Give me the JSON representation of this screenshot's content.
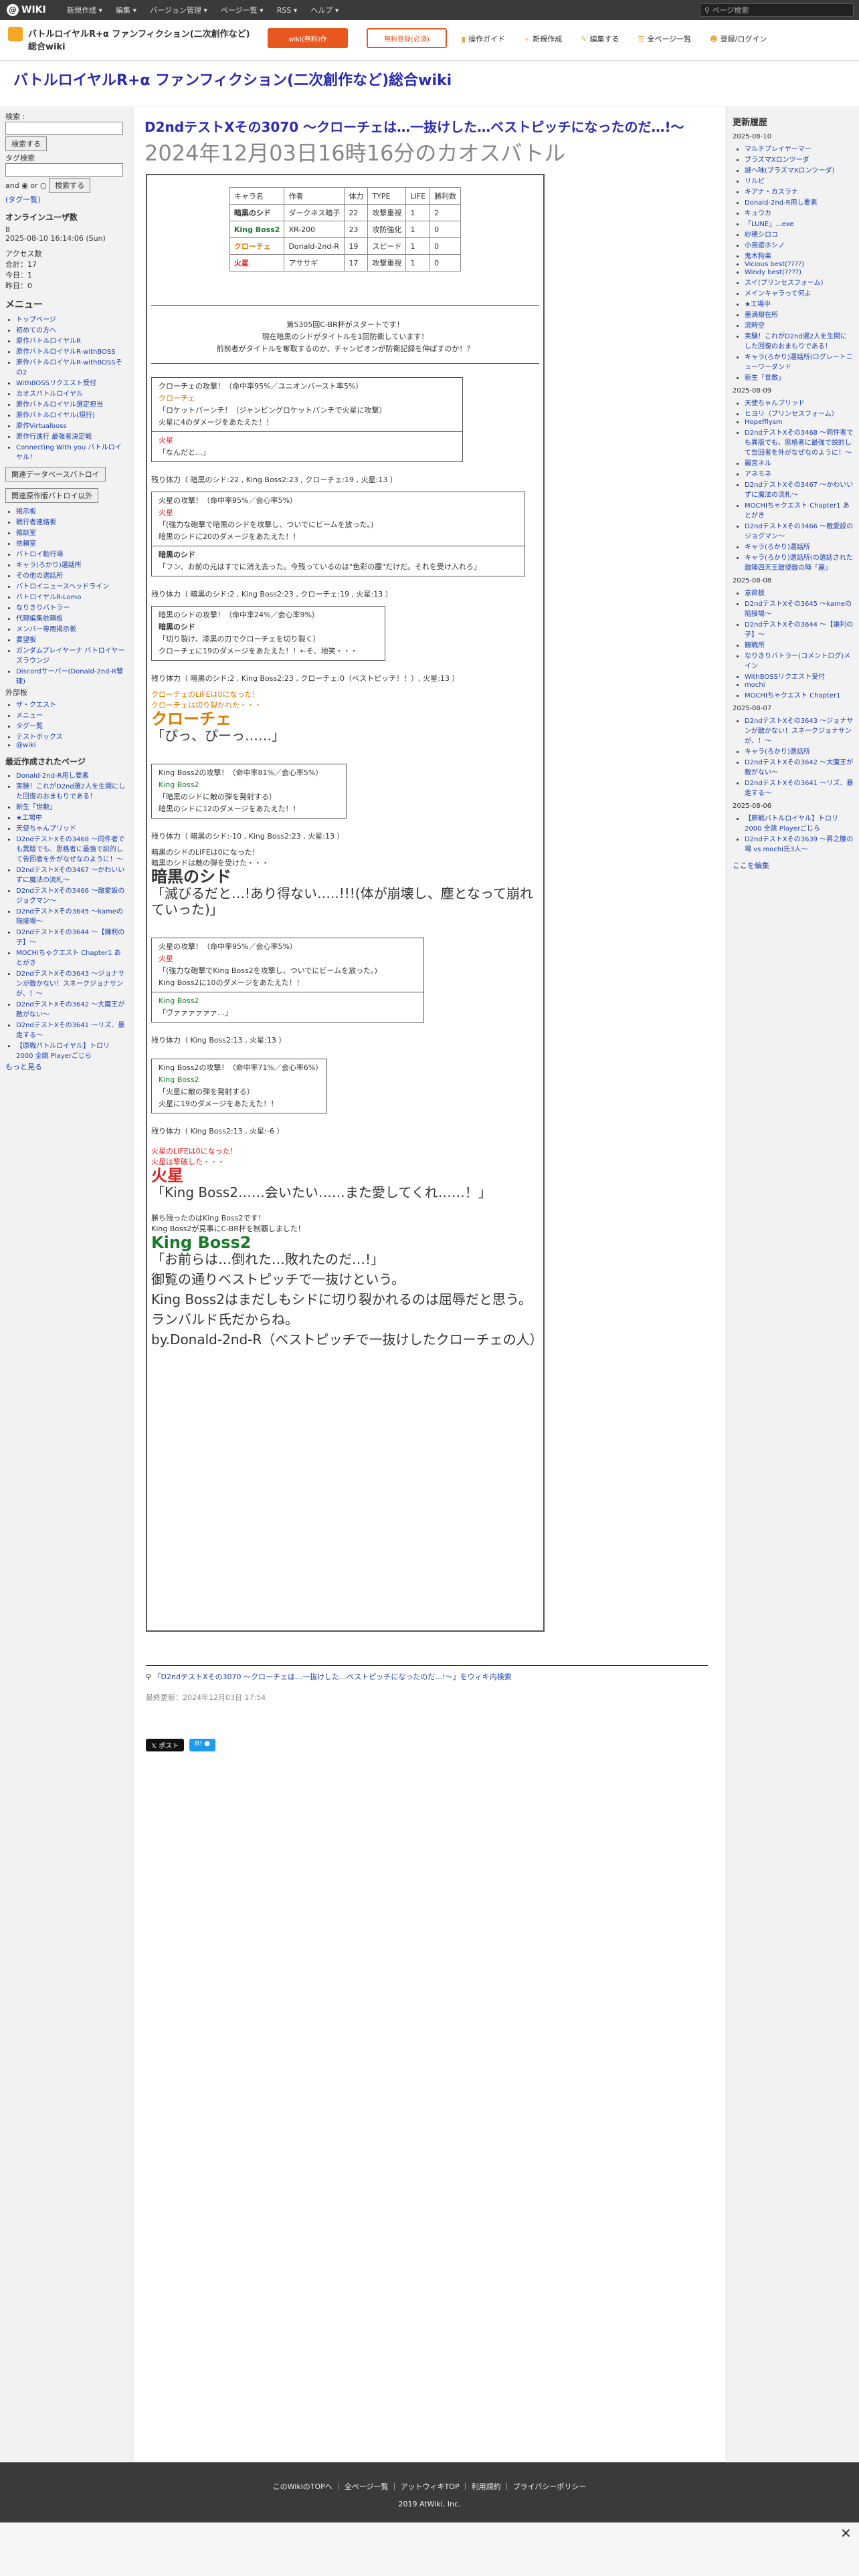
{
  "topbar": {
    "logo": "WIKI",
    "menus": [
      "新規作成 ▾",
      "編集 ▾",
      "バージョン管理 ▾",
      "ページ一覧 ▾",
      "RSS ▾",
      "ヘルプ ▾"
    ],
    "search_placeholder": "ページ検索"
  },
  "header": {
    "wiki_name": "バトルロイヤルR+α ファンフィクション(二次創作など)総合wiki",
    "btn_orange": "wiki(無料)作",
    "btn_white": "無料登録(必須)",
    "nav": [
      "操作ガイド",
      "新規作成",
      "編集する",
      "全ページ一覧",
      "登録/ログイン"
    ]
  },
  "page_title": "バトルロイヤルR+α ファンフィクション(二次創作など)総合wiki",
  "left": {
    "search_label": "検索 :",
    "search_btn": "検索する",
    "tag_label": "タグ検索",
    "and_or": "and ◉ or ○",
    "search_btn2": "検索する",
    "tag_list": "(タグ一覧)",
    "online_label": "オンラインユーザ数",
    "online_count": "8",
    "timestamp": "2025-08-10 16:14:06 (Sun)",
    "access_label": "アクセス数",
    "access_lines": [
      "合計：17",
      "今日：1",
      "昨日：0"
    ],
    "menu_title": "メニュー",
    "menu_items": [
      "トップページ",
      "初めての方へ",
      "原作バトルロイヤルR",
      "原作バトルロイヤルR-withBOSS",
      "原作バトルロイヤルR-withBOSSその2",
      "WithBOSSリクエスト受付",
      "カオスバトルロイヤル",
      "原作バトルロイヤル選定担当",
      "原作バトルロイヤル(現行)",
      "原作Virtualboss",
      "原作行進行 最強者決定戦",
      "Connecting With you バトルロイヤル！"
    ],
    "related_btns": [
      "関連データベースバトロイ",
      "関連原作版バトロイ以外"
    ],
    "sub_items": [
      "掲示板",
      "戦行者連絡板",
      "雑談室",
      "依頼室",
      "バトロイ勧行場",
      "キャラ(ろかり)選話所",
      "その他の選話所",
      "バトロイニュースヘッドライン",
      "バトロイヤルR-Lomo",
      "なりきりバトラー",
      "代理編集依頼板",
      "メンバー専用掲示板",
      "要望板",
      "ガンダムプレイヤーナ バトロイヤーズラウンジ",
      "Discordサーバー(Donald-2nd-R管理)"
    ],
    "ext_label": "外部板",
    "ext_items": [
      "ザ・クエスト",
      "メニュー",
      "タグ一覧",
      "テストボックス",
      "@wiki"
    ],
    "recent_title": "最近作成されたページ",
    "recent_items": [
      "Donald-2nd-R用し要素",
      "実験！これがD2nd選2人を生開にした回復のおまもりである！",
      "新生「世敷」",
      "★工場中",
      "天使ちゃんプリッド",
      "D2ndテストXその3468 〜同件者でも異版でも、思格者に最強で説的して告回者を外がなぜなのように！〜",
      "D2ndテストXその3467 〜かわいいずに魔法の流札〜",
      "D2ndテストXその3466 〜敵愛設のジョグマン〜",
      "D2ndテストXその3645 〜kameの陥接場〜",
      "D2ndテストXその3644 〜【嫌利の子】〜",
      "MOCHIちゃクエスト Chapter1 あとがき",
      "D2ndテストXその3643 〜ジョナサンが敵かない！スネークジョナサンが、！〜",
      "D2ndテストXその3642 〜大魔王が敵がない〜",
      "D2ndテストXその3641 〜リズ、暴走する〜",
      "【原戦バトルロイヤル】トロリ2000 全跳 Playerごじら"
    ],
    "more_recent": "もっと見る"
  },
  "right": {
    "title": "更新履歴",
    "groups": [
      {
        "date": "2025-08-10",
        "items": [
          "マルチプレイヤーマー",
          "ブラズマXロンツーダ",
          "謎へ味(ブラズマXロンツーダ)",
          "リルビ",
          "キアナ・カスラナ",
          "Donald-2nd-R用し要素",
          "キュウカ",
          "「LUNE」...exe",
          "紗穂シロコ",
          "小鳥遊ホシノ",
          "鬼木狗楽",
          "Vicious best(????)",
          "Windy best(????)",
          "スイ(プリンセスフォーム)",
          "メインキャラって何よ",
          "★工場中",
          "墨満樹在所",
          "流時空",
          "実験！これがD2nd選2人を生開にした回復のおまもりである！",
          "キャラ(ろかり)選話所(ログレートニューワーダンド",
          "新生「世敷」"
        ]
      },
      {
        "date": "2025-08-09",
        "items": [
          "天使ちゃんプリッド",
          "ヒヨリ（プリンセスフォーム）",
          "Hopefflysm",
          "D2ndテストXその3468 〜同件者でも異版でも、思格者に最強で説的して告回者を外がなぜなのように！〜",
          "麗宮ネル",
          "アネモネ",
          "D2ndテストXその3467 〜かわいいずに魔法の流札〜",
          "MOCHIちゃクエスト Chapter1 あとがき",
          "D2ndテストXその3466 〜敵愛設のジョグマン〜",
          "キャラ(ろかり)選話所",
          "キャラ(ろかり)選話所(の選話された敵陣四天王敵侵敵の陣「麗」"
        ]
      },
      {
        "date": "2025-08-08",
        "items": [
          "意欲板",
          "D2ndテストXその3645 〜kameの陥接場〜",
          "D2ndテストXその3644 〜【嫌利の子】〜",
          "観戦所",
          "なりきりバトラー(コメントログ)メイン",
          "WithBOSSリクエスト受付",
          "mochi",
          "MOCHIちゃクエスト Chapter1"
        ]
      },
      {
        "date": "2025-08-07",
        "items": [
          "D2ndテストXその3643 〜ジョナサンが敵かない！スネークジョナサンが、！〜",
          "キャラ(ろかり)選話所",
          "D2ndテストXその3642 〜大魔王が敵がない〜",
          "D2ndテストXその3641 〜リズ、暴走する〜"
        ]
      },
      {
        "date": "2025-08-06",
        "items": [
          "【原戦バトルロイヤル】トロリ2000 全跳 Playerごじら",
          "D2ndテストXその3639 〜昇之腰の場 vs mochi氏3人〜"
        ]
      }
    ],
    "more": "ここを編集"
  },
  "article": {
    "title": "D2ndテストXその3070 〜クローチェは…一抜けした…ベストピッチになったのだ…!〜",
    "date": "2024年12月03日16時16分のカオスバトル",
    "table_header": [
      "キャラ名",
      "作者",
      "体力",
      "TYPE",
      "LIFE",
      "勝利数"
    ],
    "table_rows": [
      [
        "暗黒のシド",
        "ダークネス暗子",
        "22",
        "攻撃重視",
        "1",
        "2"
      ],
      [
        "King Boss2",
        "XR-200",
        "23",
        "攻防強化",
        "1",
        "0"
      ],
      [
        "クローチェ",
        "Donald-2nd-R",
        "19",
        "スピード",
        "1",
        "0"
      ],
      [
        "火星",
        "アササギ",
        "17",
        "攻撃重視",
        "1",
        "0"
      ]
    ],
    "intro": [
      "第5305回C-BR杯がスタートです！",
      "現在暗黒のシドがタイトルを1回防衛しています！",
      "前前者がタイトルを奪取するのか、チャンピオンが防衛記録を伸ばすのか！？"
    ],
    "f1": [
      "クローチェの攻撃！（命中率95%／ユニオンバースト率5%）",
      "クローチェ",
      "「ロケットパーンチ！（ジャンピングロケットパンチで火星に攻撃）",
      "火星に4のダメージをあたえた！！",
      "火星",
      "「なんだと…」"
    ],
    "hp1": "残り体力（ 暗黒のシド:22 , King Boss2:23 , クローチェ:19 , 火星:13 ）",
    "f2": [
      "火星の攻撃！（命中率95%／会心率5%）",
      "火星",
      "「(強力な砲撃で暗黒のシドを攻撃し、ついでにビームを放った。)",
      "暗黒のシドに20のダメージをあたえた！！",
      "暗黒のシド",
      "「フン、お前の元はすでに消え去った。今残っているのは\"色彩の塵\"だけだ。それを受け入れろ」"
    ],
    "hp2": "残り体力（ 暗黒のシド:2 , King Boss2:23 , クローチェ:19 , 火星:13 ）",
    "f3": [
      "暗黒のシドの攻撃！（命中率24%／会心率9%）",
      "暗黒のシド",
      "「切り裂け、漆黒の刃でクローチェを切り裂く）",
      "クローチェに19のダメージをあたえた！！←そ、地笑・・・"
    ],
    "hp3": "残り体力（ 暗黒のシド:2 , King Boss2:23 , クローチェ:0（ベストピッチ！！）, 火星:13 ）",
    "croce_out": [
      "クローチェのLIFEは0になった！",
      "クローチェは切り裂かれた・・・"
    ],
    "croce_name": "クローチェ",
    "croce_line": "「ぴっ、ぴーっ……」",
    "f4": [
      "King Boss2の攻撃！（命中率81%／会心率5%）",
      "King Boss2",
      "「暗黒のシドに敵の弾を発射する）",
      "暗黒のシドに12のダメージをあたえた！！"
    ],
    "hp4": "残り体力（ 暗黒のシド:-10 , King Boss2:23 , 火星:13 ）",
    "sid_out": [
      "暗黒のシドのLIFEは0になった！",
      "暗黒のシドは敵の弾を受けた・・・"
    ],
    "sid_name": "暗黒のシド",
    "sid_line": "「滅びるだと…!あり得ない…..!!!(体が崩壊し、塵となって崩れていった)」",
    "f5": [
      "火星の攻撃！（命中率95%／会心率5%）",
      "火星",
      "「(強力な砲撃でKing Boss2を攻撃し、ついでにビームを放った。)",
      "King Boss2に10のダメージをあたえた！！",
      "King Boss2",
      "「ヴァァァァァァ…」"
    ],
    "hp5": "残り体力（ King Boss2:13 , 火星:13 ）",
    "f6": [
      "King Boss2の攻撃！（命中率71%／会心率6%）",
      "King Boss2",
      "「火星に敵の弾を発射する）",
      "火星に19のダメージをあたえた！！"
    ],
    "hp6": "残り体力（ King Boss2:13 , 火星:-6 ）",
    "mars_out": [
      "火星のLIFEは0になった！",
      "火星は撃破した・・・"
    ],
    "mars_name": "火星",
    "mars_line": "「King Boss2……会いたい……また愛してくれ……！」",
    "win": [
      "勝ち残ったのはKing Boss2です！",
      "King Boss2が見事にC-BR杯を制覇しました！"
    ],
    "winner_name": "King Boss2",
    "winner_line": "「お前らは…倒れた…敗れたのだ…!」",
    "closing": [
      "御覧の通りベストピッチで一抜けという。",
      "King Boss2はまだしもシドに切り裂かれるのは屈辱だと思う。",
      "ランバルド氏だからね。",
      "by.Donald-2nd-R（ベストピッチで一抜けしたクローチェの人）"
    ],
    "after_link": "「D2ndテストXその3070 〜クローチェは…一抜けした…ベストピッチになったのだ…!〜」をウィキ内検索",
    "updated": "最終更新：2024年12月03日 17:54",
    "sns": [
      "𝕏 ポスト",
      "B! ●"
    ]
  },
  "footer": {
    "links": [
      "このWikiのTOPへ",
      "全ページ一覧",
      "アットウィキTOP",
      "利用規約",
      "プライバシーポリシー"
    ],
    "copy": "2019 AtWiki, Inc."
  },
  "colors": {
    "accent": "#e8571e",
    "link": "#1a3fb0",
    "title": "#2b2bb3"
  }
}
